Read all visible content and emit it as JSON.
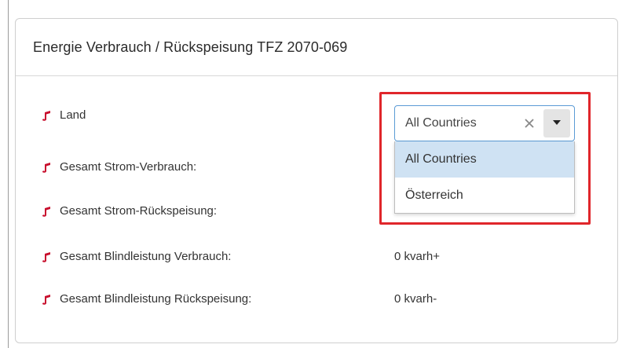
{
  "panel": {
    "title": "Energie Verbrauch / Rückspeisung TFZ 2070-069"
  },
  "rows": [
    {
      "label": "Land",
      "value": ""
    },
    {
      "label": "Gesamt Strom-Verbrauch:",
      "value": ""
    },
    {
      "label": "Gesamt Strom-Rückspeisung:",
      "value": ""
    },
    {
      "label": "Gesamt Blindleistung Verbrauch:",
      "value": "0 kvarh+"
    },
    {
      "label": "Gesamt Blindleistung Rückspeisung:",
      "value": "0 kvarh-"
    }
  ],
  "country_select": {
    "selected": "All Countries",
    "options": [
      "All Countries",
      "Österreich"
    ],
    "highlighted_index": 0
  },
  "colors": {
    "icon": "#c8102e",
    "highlight_frame": "#e0262b",
    "select_border": "#5b9bd5",
    "option_highlight": "#cfe2f3"
  },
  "icons": {
    "row_icon": "music-note-icon",
    "clear": "close-icon",
    "caret": "caret-down-icon"
  }
}
